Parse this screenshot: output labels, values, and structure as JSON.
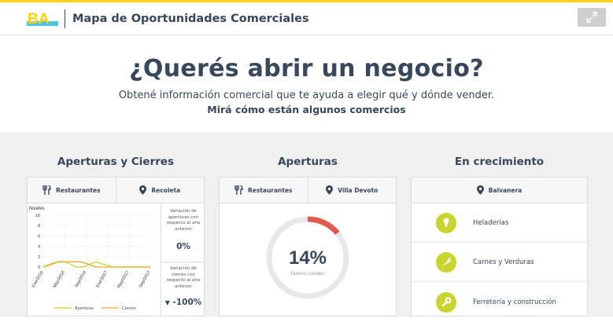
{
  "header": {
    "logo_text": "BA",
    "title": "Mapa de Oportunidades Comerciales"
  },
  "hero": {
    "title": "¿Querés abrir un negocio?",
    "subtitle": "Obtené información comercial que te ayuda a elegir qué y dónde vender.",
    "subtitle_bold": "Mirá cómo están algunos comercios"
  },
  "col1": {
    "title": "Aperturas y Cierres",
    "tab_category": "Restaurantes",
    "tab_location": "Recoleta",
    "kpi_open_label": "Variación de aperturas con respecto al año anterior",
    "kpi_open_value": "0%",
    "kpi_close_label": "Variación de cierres con respecto al año anterior",
    "kpi_close_value": "-100%"
  },
  "col2": {
    "title": "Aperturas",
    "tab_category": "Restaurantes",
    "tab_location": "Villa Devoto",
    "donut_value": "14%",
    "donut_label": "Nuevos Locales",
    "donut_fraction": 0.14
  },
  "col3": {
    "title": "En crecimiento",
    "tab_location": "Balvanera",
    "items": [
      {
        "label": "Heladerías",
        "icon": "ice-cream-icon"
      },
      {
        "label": "Carnes y Verduras",
        "icon": "carrot-icon"
      },
      {
        "label": "Ferretería y construcción",
        "icon": "wrench-icon"
      }
    ]
  },
  "colors": {
    "accent_yellow": "#fdd306",
    "text_dark": "#38485c",
    "green": "#c8d42f",
    "orange": "#f5a623",
    "red": "#e05a4f",
    "band": "#f0f0f0"
  },
  "chart_data": {
    "type": "line",
    "ylabel": "Niveles",
    "ylim": [
      0,
      10
    ],
    "yticks": [
      0,
      2,
      4,
      6,
      8,
      10
    ],
    "categories": [
      "Ene/2016",
      "May/2016",
      "Sep/2016",
      "Ene/2017",
      "May/2017",
      "Sep/2017"
    ],
    "x": [
      0,
      1,
      2,
      3,
      4,
      5,
      6,
      7,
      8,
      9,
      10,
      11,
      12,
      13,
      14,
      15,
      16,
      17,
      18,
      19,
      20
    ],
    "series": [
      {
        "name": "Aperturas",
        "color": "#c8d42f",
        "values": [
          0,
          0.3,
          0.7,
          1,
          1,
          0.6,
          0,
          0,
          0.2,
          0.7,
          1,
          0.6,
          0.3,
          0,
          0,
          0,
          0,
          0,
          0,
          0,
          0
        ]
      },
      {
        "name": "Cierres",
        "color": "#f5a623",
        "values": [
          0,
          0.4,
          0.8,
          1,
          1,
          1,
          1,
          1,
          0.7,
          0.3,
          0,
          0,
          0,
          0,
          0,
          0,
          0,
          0,
          0,
          0,
          0
        ]
      }
    ],
    "grid": true,
    "legend": "bottom"
  }
}
